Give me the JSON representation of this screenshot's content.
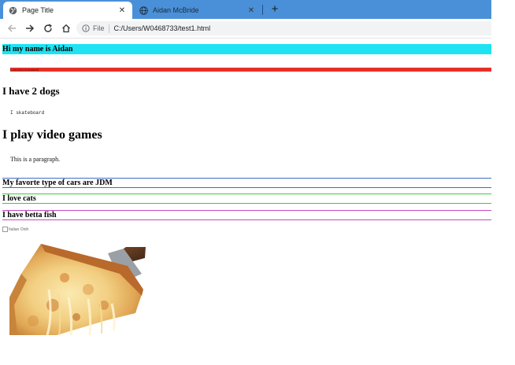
{
  "browser": {
    "tabs": [
      {
        "title": "Page Title",
        "close": "✕",
        "active": true
      },
      {
        "title": "Aidan McBride",
        "close": "✕",
        "active": false
      }
    ],
    "new_tab": "+",
    "address": {
      "security_label": "File",
      "url": "C:/Users/W0468733/test1.html"
    },
    "colors": {
      "tabstrip": "#4a90d9",
      "omnibox": "#f1f3f4"
    }
  },
  "page": {
    "heading_aidan": "Hi my name is Aidan",
    "small_red_text": "I was born in montreal",
    "heading_dogs": "I have 2 dogs",
    "skateboard_text": "I skateboard",
    "heading_games": "I play video games",
    "paragraph": "This is a paragraph.",
    "box_cars": "My favorte type of cars are JDM",
    "box_cats": "I love cats",
    "box_fish": "I have betta fish",
    "broken_image_alt": "Italian Onih",
    "pizza_image": "pizza-slice-photo"
  },
  "colors": {
    "cyan_bar": "#1de3f2",
    "red_bar": "#e63026",
    "blue_border": "#3e6fc4",
    "green_border": "#3ccb3c",
    "magenta_border": "#c64ac6"
  }
}
